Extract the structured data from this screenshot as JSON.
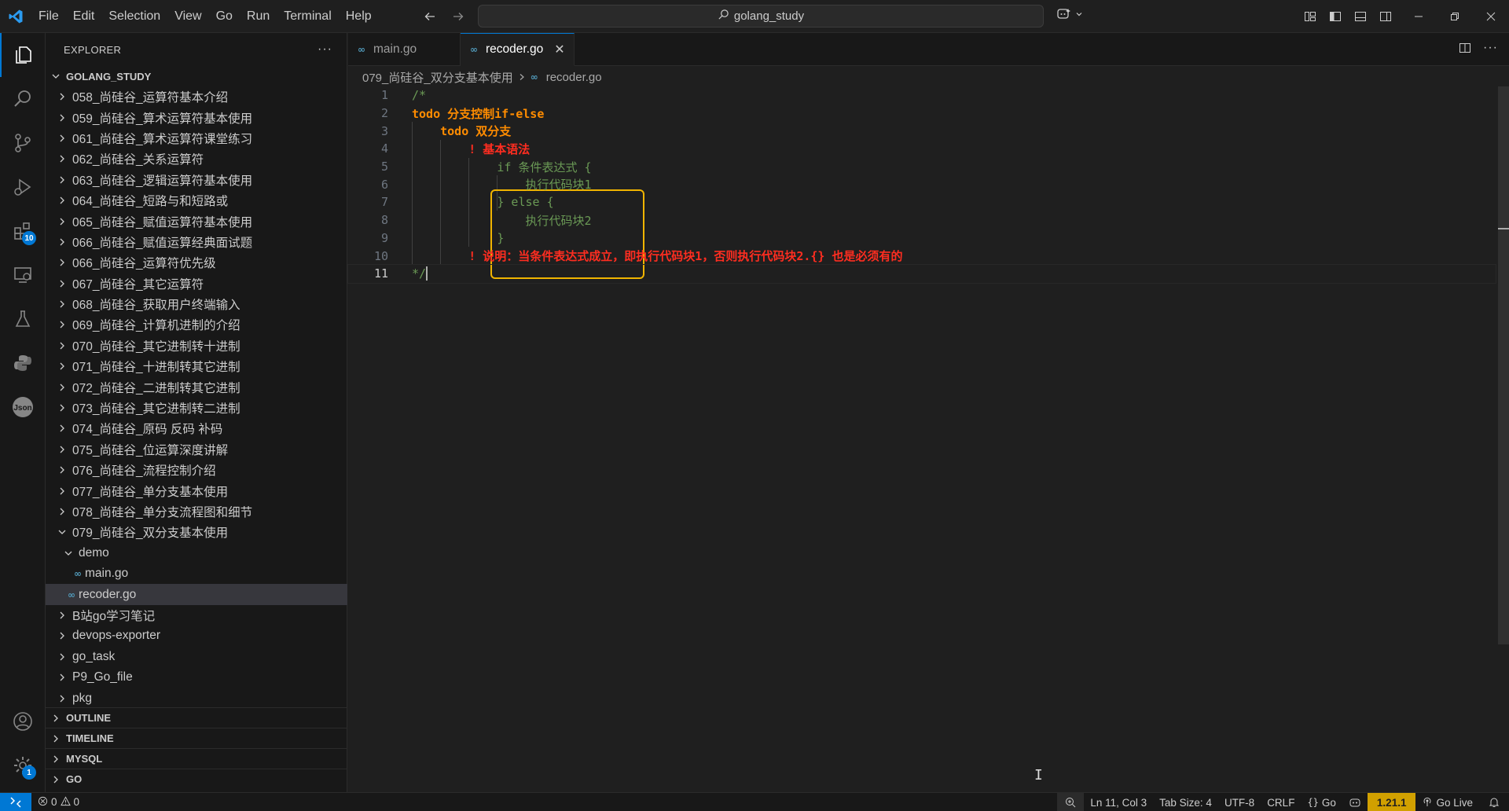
{
  "colors": {
    "accent": "#0078d4",
    "todo": "#ff8c00",
    "alert": "#ff2d20",
    "comment": "#6a9955",
    "highlight_border": "#f0b400",
    "go_version_bg": "#d1a000"
  },
  "menu": [
    "File",
    "Edit",
    "Selection",
    "View",
    "Go",
    "Run",
    "Terminal",
    "Help"
  ],
  "command_center": {
    "text": "golang_study",
    "icon": "search-icon"
  },
  "activity_bar": {
    "items": [
      {
        "icon": "explorer-icon",
        "active": true
      },
      {
        "icon": "search-icon"
      },
      {
        "icon": "source-control-icon"
      },
      {
        "icon": "run-debug-icon"
      },
      {
        "icon": "extensions-icon",
        "badge": "10"
      },
      {
        "icon": "remote-explorer-icon"
      },
      {
        "icon": "testing-icon"
      },
      {
        "icon": "python-icon"
      },
      {
        "icon": "json-icon",
        "label": "Json"
      }
    ],
    "bottom": [
      {
        "icon": "account-icon"
      },
      {
        "icon": "manage-gear-icon",
        "badge": "1"
      }
    ]
  },
  "sidebar": {
    "title": "EXPLORER",
    "workspace": "GOLANG_STUDY",
    "tree": [
      {
        "label": "058_尚硅谷_运算符基本介绍",
        "type": "folder",
        "level": 1
      },
      {
        "label": "059_尚硅谷_算术运算符基本使用",
        "type": "folder",
        "level": 1
      },
      {
        "label": "061_尚硅谷_算术运算符课堂练习",
        "type": "folder",
        "level": 1
      },
      {
        "label": "062_尚硅谷_关系运算符",
        "type": "folder",
        "level": 1
      },
      {
        "label": "063_尚硅谷_逻辑运算符基本使用",
        "type": "folder",
        "level": 1
      },
      {
        "label": "064_尚硅谷_短路与和短路或",
        "type": "folder",
        "level": 1
      },
      {
        "label": "065_尚硅谷_赋值运算符基本使用",
        "type": "folder",
        "level": 1
      },
      {
        "label": "066_尚硅谷_赋值运算经典面试题",
        "type": "folder",
        "level": 1
      },
      {
        "label": "066_尚硅谷_运算符优先级",
        "type": "folder",
        "level": 1
      },
      {
        "label": "067_尚硅谷_其它运算符",
        "type": "folder",
        "level": 1
      },
      {
        "label": "068_尚硅谷_获取用户终端输入",
        "type": "folder",
        "level": 1
      },
      {
        "label": "069_尚硅谷_计算机进制的介绍",
        "type": "folder",
        "level": 1
      },
      {
        "label": "070_尚硅谷_其它进制转十进制",
        "type": "folder",
        "level": 1
      },
      {
        "label": "071_尚硅谷_十进制转其它进制",
        "type": "folder",
        "level": 1
      },
      {
        "label": "072_尚硅谷_二进制转其它进制",
        "type": "folder",
        "level": 1
      },
      {
        "label": "073_尚硅谷_其它进制转二进制",
        "type": "folder",
        "level": 1
      },
      {
        "label": "074_尚硅谷_原码 反码 补码",
        "type": "folder",
        "level": 1
      },
      {
        "label": "075_尚硅谷_位运算深度讲解",
        "type": "folder",
        "level": 1
      },
      {
        "label": "076_尚硅谷_流程控制介绍",
        "type": "folder",
        "level": 1
      },
      {
        "label": "077_尚硅谷_单分支基本使用",
        "type": "folder",
        "level": 1
      },
      {
        "label": "078_尚硅谷_单分支流程图和细节",
        "type": "folder",
        "level": 1
      },
      {
        "label": "079_尚硅谷_双分支基本使用",
        "type": "folder-open",
        "level": 1
      },
      {
        "label": "demo",
        "type": "folder-open",
        "level": 2
      },
      {
        "label": "main.go",
        "type": "go-file",
        "level": 3
      },
      {
        "label": "recoder.go",
        "type": "go-file",
        "level": 2,
        "selected": true
      },
      {
        "label": "B站go学习笔记",
        "type": "folder",
        "level": 1
      },
      {
        "label": "devops-exporter",
        "type": "folder",
        "level": 1
      },
      {
        "label": "go_task",
        "type": "folder",
        "level": 1
      },
      {
        "label": "P9_Go_file",
        "type": "folder",
        "level": 1
      },
      {
        "label": "pkg",
        "type": "folder",
        "level": 1
      }
    ],
    "sections": [
      "OUTLINE",
      "TIMELINE",
      "MYSQL",
      "GO"
    ]
  },
  "tabs": [
    {
      "label": "main.go",
      "active": false
    },
    {
      "label": "recoder.go",
      "active": true
    }
  ],
  "breadcrumb": {
    "folder": "079_尚硅谷_双分支基本使用",
    "file": "recoder.go"
  },
  "code_lines": [
    {
      "n": "1",
      "segs": [
        [
          "c-comment",
          "/*"
        ]
      ]
    },
    {
      "n": "2",
      "segs": [
        [
          "c-todo",
          "todo 分支控制if-else"
        ]
      ]
    },
    {
      "n": "3",
      "segs": [
        [
          "c-todo",
          "    todo 双分支"
        ]
      ]
    },
    {
      "n": "4",
      "segs": [
        [
          "c-alert",
          "        ! 基本语法"
        ]
      ]
    },
    {
      "n": "5",
      "segs": [
        [
          "c-snip",
          "            if 条件表达式 {"
        ]
      ]
    },
    {
      "n": "6",
      "segs": [
        [
          "c-snip",
          "                执行代码块1"
        ]
      ]
    },
    {
      "n": "7",
      "segs": [
        [
          "c-snip",
          "            } else {"
        ]
      ]
    },
    {
      "n": "8",
      "segs": [
        [
          "c-snip",
          "                执行代码块2"
        ]
      ]
    },
    {
      "n": "9",
      "segs": [
        [
          "c-snip",
          "            }"
        ]
      ]
    },
    {
      "n": "10",
      "segs": [
        [
          "c-alert",
          "        ! 说明：当条件表达式成立，即执行代码块1，否则执行代码块2.{} 也是必须有的"
        ]
      ]
    },
    {
      "n": "11",
      "segs": [
        [
          "c-comment",
          "*/"
        ]
      ],
      "current": true
    }
  ],
  "status": {
    "errors": "0",
    "warnings": "0",
    "position": "Ln 11, Col 3",
    "tab_size": "Tab Size: 4",
    "encoding": "UTF-8",
    "eol": "CRLF",
    "language": "Go",
    "go_version": "1.21.1",
    "go_live": "Go Live"
  }
}
